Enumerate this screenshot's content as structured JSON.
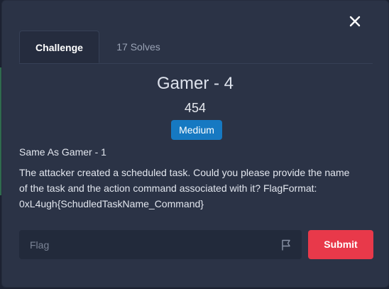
{
  "modal": {
    "close_icon": "close-icon"
  },
  "tabs": [
    {
      "label": "Challenge",
      "active": true
    },
    {
      "label": "17 Solves",
      "active": false
    }
  ],
  "challenge": {
    "title": "Gamer - 4",
    "points": "454",
    "difficulty": "Medium",
    "difficulty_color": "#1679c2",
    "subtitle": "Same As Gamer - 1",
    "description_lines": [
      "The attacker created a scheduled task. Could you please provide the name",
      "of the task and the action command associated with it? FlagFormat:",
      "0xL4ugh{SchudledTaskName_Command}"
    ]
  },
  "form": {
    "flag_placeholder": "Flag",
    "flag_value": "",
    "flag_icon": "flag-icon",
    "submit_label": "Submit",
    "submit_color": "#e8394a"
  }
}
